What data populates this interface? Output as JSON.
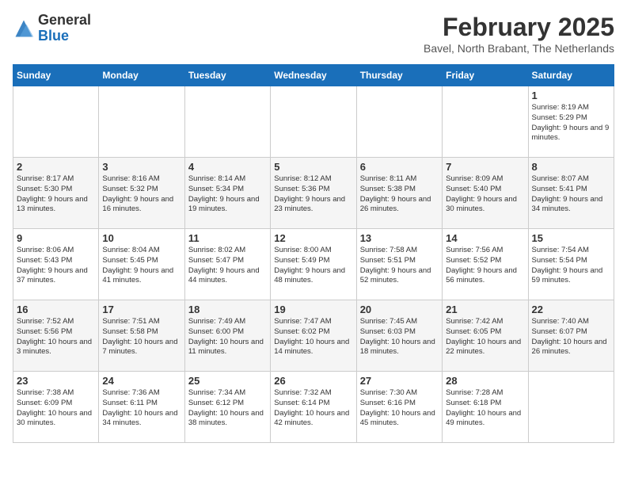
{
  "header": {
    "logo_general": "General",
    "logo_blue": "Blue",
    "title": "February 2025",
    "subtitle": "Bavel, North Brabant, The Netherlands"
  },
  "days_of_week": [
    "Sunday",
    "Monday",
    "Tuesday",
    "Wednesday",
    "Thursday",
    "Friday",
    "Saturday"
  ],
  "weeks": [
    [
      {
        "day": "",
        "info": ""
      },
      {
        "day": "",
        "info": ""
      },
      {
        "day": "",
        "info": ""
      },
      {
        "day": "",
        "info": ""
      },
      {
        "day": "",
        "info": ""
      },
      {
        "day": "",
        "info": ""
      },
      {
        "day": "1",
        "info": "Sunrise: 8:19 AM\nSunset: 5:29 PM\nDaylight: 9 hours and 9 minutes."
      }
    ],
    [
      {
        "day": "2",
        "info": "Sunrise: 8:17 AM\nSunset: 5:30 PM\nDaylight: 9 hours and 13 minutes."
      },
      {
        "day": "3",
        "info": "Sunrise: 8:16 AM\nSunset: 5:32 PM\nDaylight: 9 hours and 16 minutes."
      },
      {
        "day": "4",
        "info": "Sunrise: 8:14 AM\nSunset: 5:34 PM\nDaylight: 9 hours and 19 minutes."
      },
      {
        "day": "5",
        "info": "Sunrise: 8:12 AM\nSunset: 5:36 PM\nDaylight: 9 hours and 23 minutes."
      },
      {
        "day": "6",
        "info": "Sunrise: 8:11 AM\nSunset: 5:38 PM\nDaylight: 9 hours and 26 minutes."
      },
      {
        "day": "7",
        "info": "Sunrise: 8:09 AM\nSunset: 5:40 PM\nDaylight: 9 hours and 30 minutes."
      },
      {
        "day": "8",
        "info": "Sunrise: 8:07 AM\nSunset: 5:41 PM\nDaylight: 9 hours and 34 minutes."
      }
    ],
    [
      {
        "day": "9",
        "info": "Sunrise: 8:06 AM\nSunset: 5:43 PM\nDaylight: 9 hours and 37 minutes."
      },
      {
        "day": "10",
        "info": "Sunrise: 8:04 AM\nSunset: 5:45 PM\nDaylight: 9 hours and 41 minutes."
      },
      {
        "day": "11",
        "info": "Sunrise: 8:02 AM\nSunset: 5:47 PM\nDaylight: 9 hours and 44 minutes."
      },
      {
        "day": "12",
        "info": "Sunrise: 8:00 AM\nSunset: 5:49 PM\nDaylight: 9 hours and 48 minutes."
      },
      {
        "day": "13",
        "info": "Sunrise: 7:58 AM\nSunset: 5:51 PM\nDaylight: 9 hours and 52 minutes."
      },
      {
        "day": "14",
        "info": "Sunrise: 7:56 AM\nSunset: 5:52 PM\nDaylight: 9 hours and 56 minutes."
      },
      {
        "day": "15",
        "info": "Sunrise: 7:54 AM\nSunset: 5:54 PM\nDaylight: 9 hours and 59 minutes."
      }
    ],
    [
      {
        "day": "16",
        "info": "Sunrise: 7:52 AM\nSunset: 5:56 PM\nDaylight: 10 hours and 3 minutes."
      },
      {
        "day": "17",
        "info": "Sunrise: 7:51 AM\nSunset: 5:58 PM\nDaylight: 10 hours and 7 minutes."
      },
      {
        "day": "18",
        "info": "Sunrise: 7:49 AM\nSunset: 6:00 PM\nDaylight: 10 hours and 11 minutes."
      },
      {
        "day": "19",
        "info": "Sunrise: 7:47 AM\nSunset: 6:02 PM\nDaylight: 10 hours and 14 minutes."
      },
      {
        "day": "20",
        "info": "Sunrise: 7:45 AM\nSunset: 6:03 PM\nDaylight: 10 hours and 18 minutes."
      },
      {
        "day": "21",
        "info": "Sunrise: 7:42 AM\nSunset: 6:05 PM\nDaylight: 10 hours and 22 minutes."
      },
      {
        "day": "22",
        "info": "Sunrise: 7:40 AM\nSunset: 6:07 PM\nDaylight: 10 hours and 26 minutes."
      }
    ],
    [
      {
        "day": "23",
        "info": "Sunrise: 7:38 AM\nSunset: 6:09 PM\nDaylight: 10 hours and 30 minutes."
      },
      {
        "day": "24",
        "info": "Sunrise: 7:36 AM\nSunset: 6:11 PM\nDaylight: 10 hours and 34 minutes."
      },
      {
        "day": "25",
        "info": "Sunrise: 7:34 AM\nSunset: 6:12 PM\nDaylight: 10 hours and 38 minutes."
      },
      {
        "day": "26",
        "info": "Sunrise: 7:32 AM\nSunset: 6:14 PM\nDaylight: 10 hours and 42 minutes."
      },
      {
        "day": "27",
        "info": "Sunrise: 7:30 AM\nSunset: 6:16 PM\nDaylight: 10 hours and 45 minutes."
      },
      {
        "day": "28",
        "info": "Sunrise: 7:28 AM\nSunset: 6:18 PM\nDaylight: 10 hours and 49 minutes."
      },
      {
        "day": "",
        "info": ""
      }
    ]
  ]
}
